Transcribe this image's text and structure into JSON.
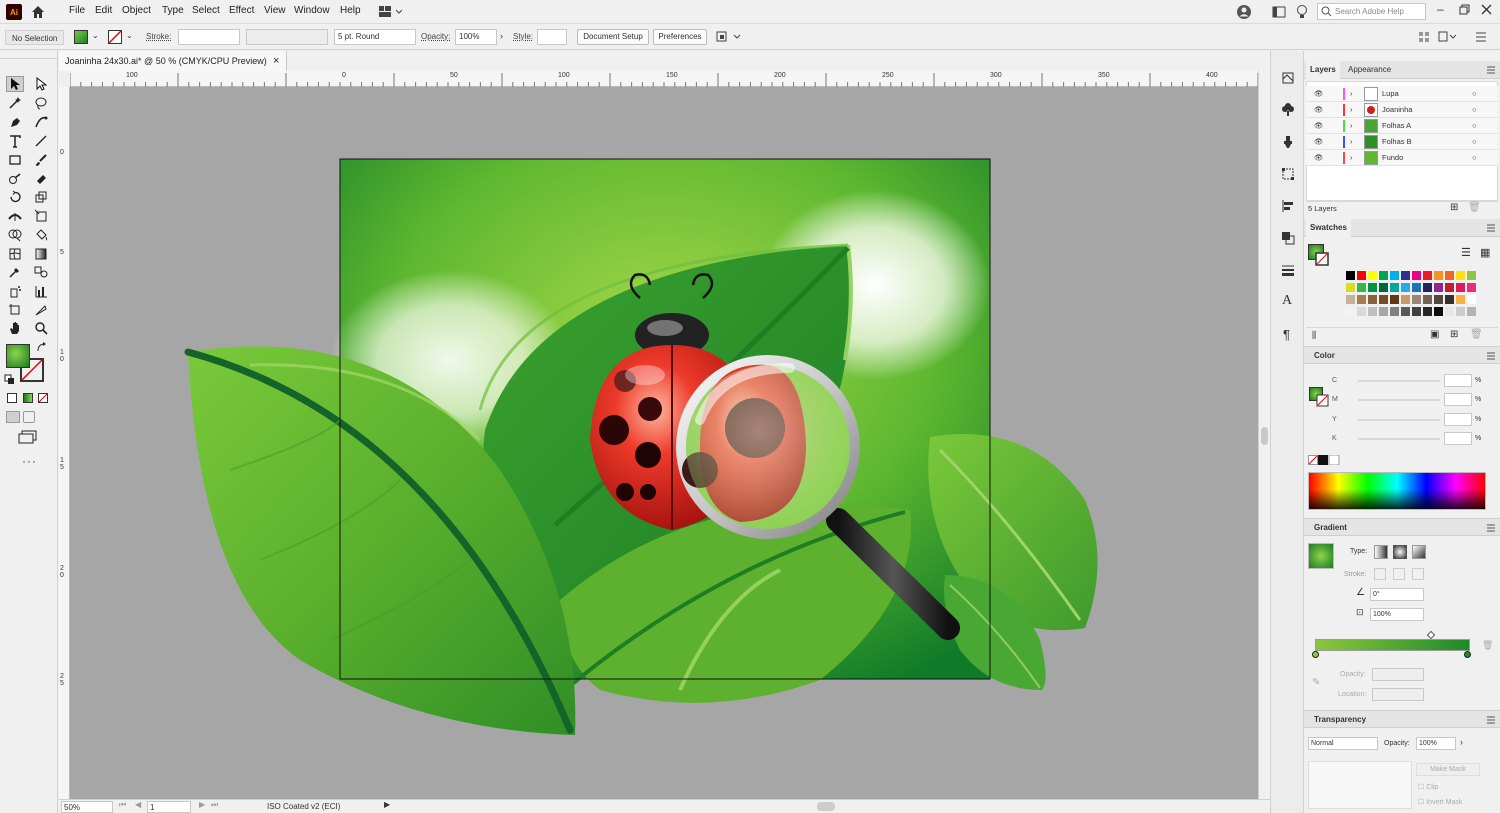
{
  "menubar": {
    "items": [
      "File",
      "Edit",
      "Object",
      "Type",
      "Select",
      "Effect",
      "View",
      "Window",
      "Help"
    ],
    "search_placeholder": "Search Adobe Help",
    "app_logo": "Ai"
  },
  "control": {
    "selection": "No Selection",
    "stroke_label": "Stroke:",
    "brush": "5 pt. Round",
    "opacity_label": "Opacity:",
    "opacity_value": "100%",
    "style_label": "Style:",
    "document_setup": "Document Setup",
    "preferences": "Preferences"
  },
  "document": {
    "tab_title": "Joaninha 24x30.ai* @ 50 % (CMYK/CPU Preview)",
    "zoom": "50%",
    "page": "1",
    "profile": "ISO Coated v2 (ECI)"
  },
  "rulers": {
    "h_ticks": [
      "100",
      "0",
      "50",
      "100",
      "150",
      "200",
      "250",
      "300",
      "350",
      "400"
    ],
    "v_ticks": [
      "0",
      "5",
      "1 0",
      "1 5",
      "2 0",
      "2 5"
    ]
  },
  "layers_panel": {
    "tabs": [
      "Layers",
      "Appearance"
    ],
    "layers": [
      {
        "name": "Lupa",
        "color": "#ff4fff"
      },
      {
        "name": "Joaninha",
        "color": "#ff3333"
      },
      {
        "name": "Folhas A",
        "color": "#44dd44"
      },
      {
        "name": "Folhas B",
        "color": "#3355ff"
      },
      {
        "name": "Fundo",
        "color": "#ff4444"
      }
    ],
    "count": "5 Layers"
  },
  "swatches_panel": {
    "title": "Swatches",
    "rows": [
      [
        "#000000",
        "#ff0000",
        "#ffff00",
        "#00a651",
        "#00aeef",
        "#2e3192",
        "#ec008c",
        "#ed1c24",
        "#f7941d",
        "#f26522",
        "#ffde17",
        "#8dc63f"
      ],
      [
        "#d7df23",
        "#39b54a",
        "#009444",
        "#006838",
        "#00a99d",
        "#29abe2",
        "#1b75bc",
        "#262262",
        "#92278f",
        "#be1e2d",
        "#d91c5c",
        "#ee2a7b"
      ],
      [
        "#c7b299",
        "#a67c52",
        "#8c6239",
        "#754c24",
        "#603913",
        "#c69c6d",
        "#998675",
        "#736357",
        "#534741",
        "#362f2d",
        "#fbb040",
        "#ffffff"
      ],
      [
        "#f2f2f2",
        "#d9d9d9",
        "#bfbfbf",
        "#a6a6a6",
        "#808080",
        "#595959",
        "#404040",
        "#262626",
        "#0d0d0d",
        "#e6e6e6",
        "#cccccc",
        "#b3b3b3"
      ]
    ]
  },
  "color_panel": {
    "title": "Color",
    "channels": [
      "C",
      "M",
      "Y",
      "K"
    ],
    "unit": "%"
  },
  "gradient_panel": {
    "title": "Gradient",
    "type_label": "Type:",
    "stroke_label": "Stroke:",
    "angle": "0°",
    "aspect": "100%",
    "opacity_label": "Opacity:",
    "location_label": "Location:"
  },
  "transparency_panel": {
    "title": "Transparency",
    "blend_mode": "Normal",
    "opacity_label": "Opacity:",
    "opacity_value": "100%",
    "make_mask": "Make Mask",
    "clip": "Clip",
    "invert_mask": "Invert Mask"
  },
  "colors": {
    "accent_green": "#1e8a2a",
    "canvas_bg": "#a6a6a6"
  }
}
